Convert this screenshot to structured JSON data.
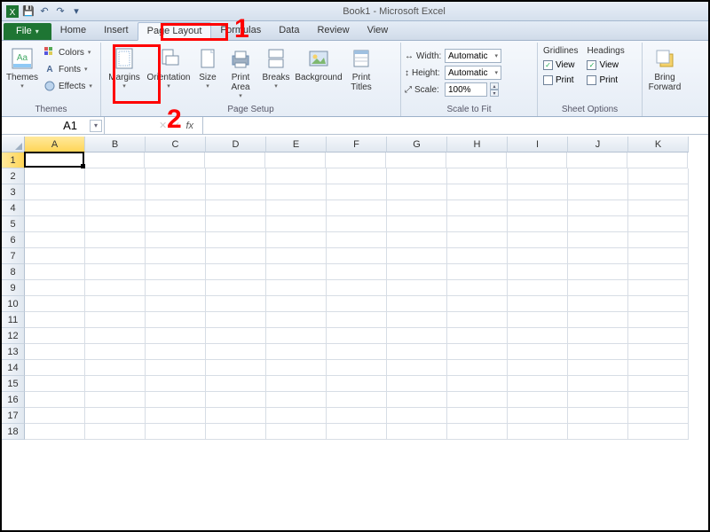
{
  "title": "Book1 - Microsoft Excel",
  "qat": {
    "save": "💾",
    "undo": "↶",
    "redo": "↷"
  },
  "tabs": {
    "file": "File",
    "items": [
      "Home",
      "Insert",
      "Page Layout",
      "Formulas",
      "Data",
      "Review",
      "View"
    ],
    "active_index": 2
  },
  "ribbon": {
    "themes": {
      "label": "Themes",
      "themes_btn": "Themes",
      "colors": "Colors",
      "fonts": "Fonts",
      "effects": "Effects"
    },
    "page_setup": {
      "label": "Page Setup",
      "margins": "Margins",
      "orientation": "Orientation",
      "size": "Size",
      "print_area": "Print\nArea",
      "breaks": "Breaks",
      "background": "Background",
      "print_titles": "Print\nTitles"
    },
    "scale": {
      "label": "Scale to Fit",
      "width_l": "Width:",
      "width_v": "Automatic",
      "height_l": "Height:",
      "height_v": "Automatic",
      "scale_l": "Scale:",
      "scale_v": "100%"
    },
    "sheet": {
      "label": "Sheet Options",
      "gridlines": "Gridlines",
      "headings": "Headings",
      "view": "View",
      "print": "Print",
      "g_view": true,
      "g_print": false,
      "h_view": true,
      "h_print": false
    },
    "arrange": {
      "bring_forward": "Bring\nForward"
    }
  },
  "namebox": "A1",
  "fx_label": "fx",
  "columns": [
    "A",
    "B",
    "C",
    "D",
    "E",
    "F",
    "G",
    "H",
    "I",
    "J",
    "K"
  ],
  "rows": 18,
  "selected": {
    "col": 0,
    "row": 0
  },
  "annotations": {
    "n1": "1",
    "n2": "2"
  }
}
